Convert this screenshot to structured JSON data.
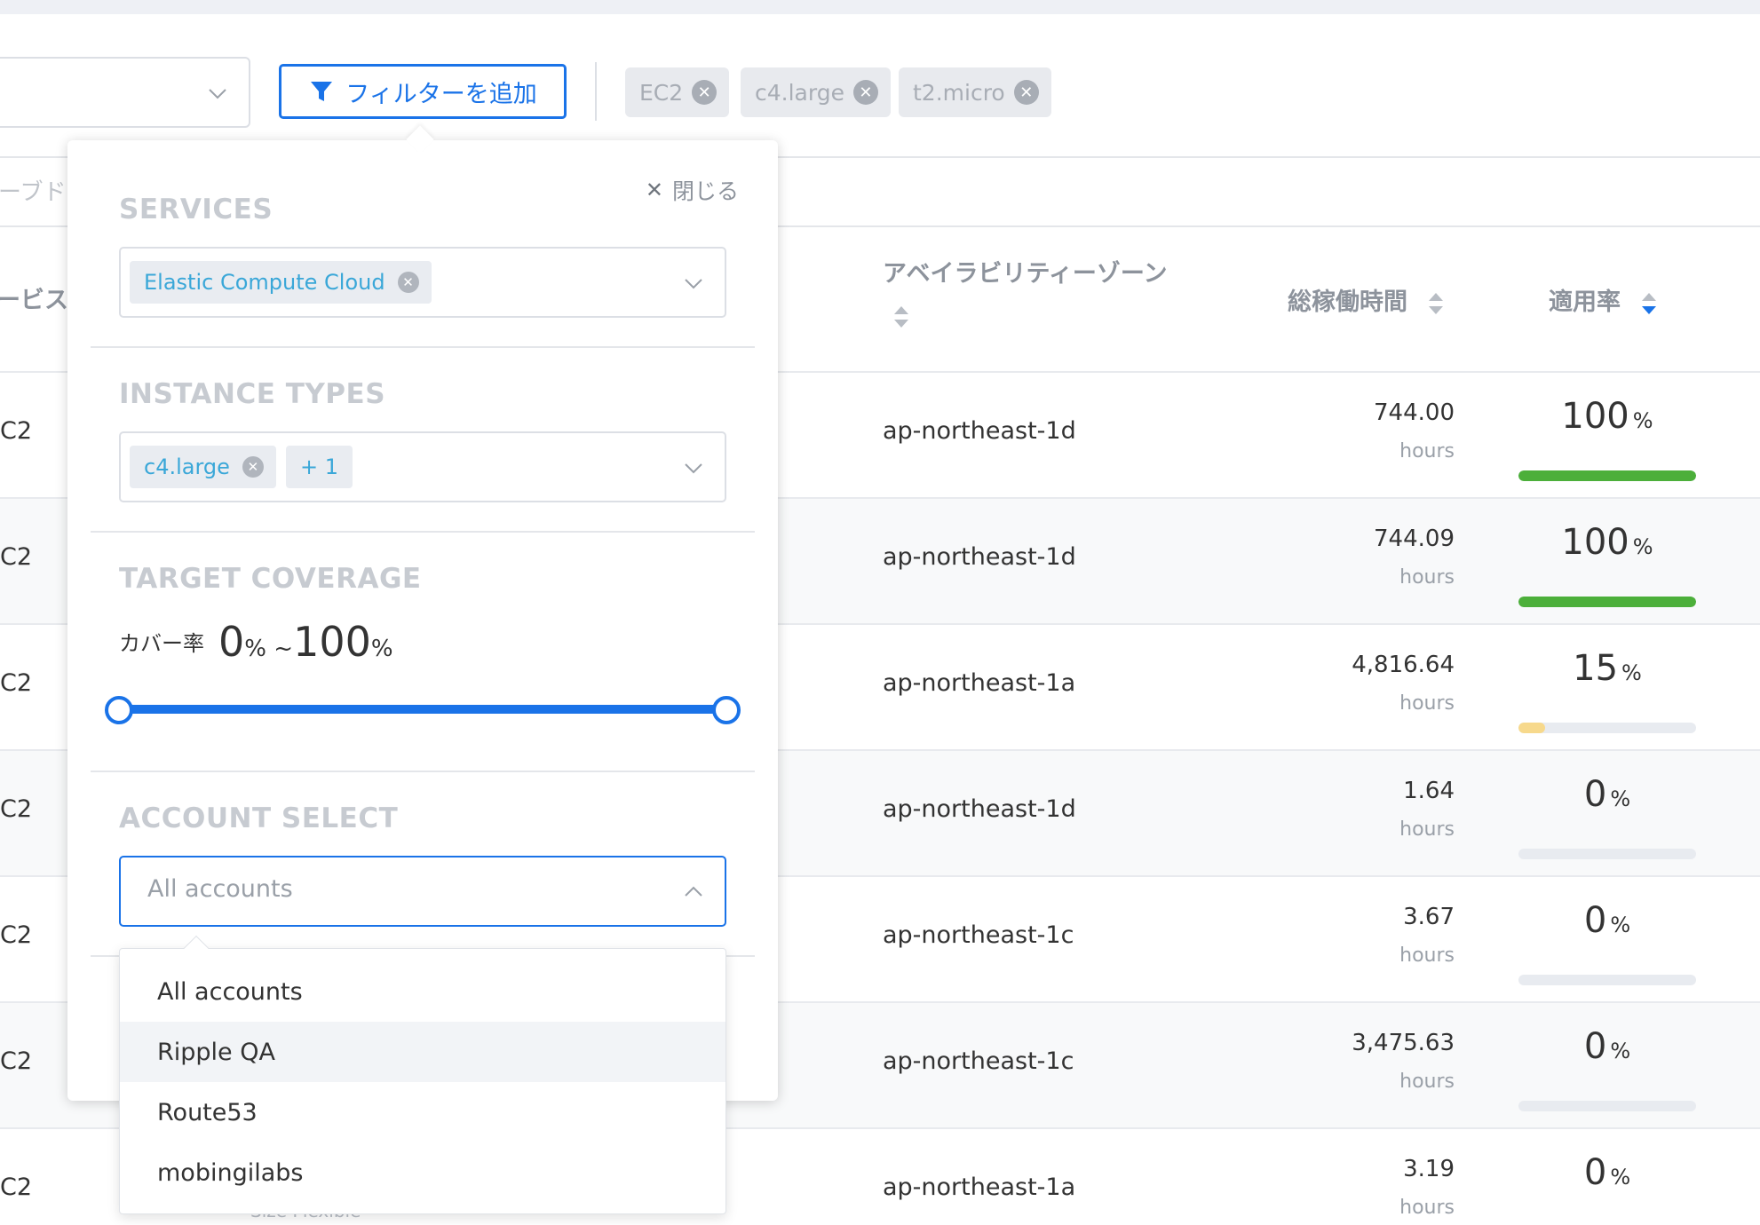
{
  "toolbar": {
    "filter_button_label": "フィルターを追加",
    "active_filters": [
      "EC2",
      "c4.large",
      "t2.micro"
    ]
  },
  "background": {
    "faded_search_text": "ーブド",
    "col_service_header": "ービス"
  },
  "table": {
    "headers": {
      "availability_zone": "アベイラビリティーゾーン",
      "total_hours": "総稼働時間",
      "coverage_rate": "適用率"
    },
    "rows": [
      {
        "service": "C2",
        "az": "ap-northeast-1d",
        "hours": "744.00",
        "hours_unit": "hours",
        "rate": "100",
        "rate_unit": "%",
        "rate_value": 100,
        "bar_color": "#4caf3a"
      },
      {
        "service": "C2",
        "az": "ap-northeast-1d",
        "hours": "744.09",
        "hours_unit": "hours",
        "rate": "100",
        "rate_unit": "%",
        "rate_value": 100,
        "bar_color": "#4caf3a"
      },
      {
        "service": "C2",
        "az": "ap-northeast-1a",
        "hours": "4,816.64",
        "hours_unit": "hours",
        "rate": "15",
        "rate_unit": "%",
        "rate_value": 15,
        "bar_color": "#f7d98c"
      },
      {
        "service": "C2",
        "az": "ap-northeast-1d",
        "hours": "1.64",
        "hours_unit": "hours",
        "rate": "0",
        "rate_unit": "%",
        "rate_value": 0,
        "bar_color": "#e8ebf0"
      },
      {
        "service": "C2",
        "az": "ap-northeast-1c",
        "hours": "3.67",
        "hours_unit": "hours",
        "rate": "0",
        "rate_unit": "%",
        "rate_value": 0,
        "bar_color": "#e8ebf0"
      },
      {
        "service": "C2",
        "az": "ap-northeast-1c",
        "hours": "3,475.63",
        "hours_unit": "hours",
        "rate": "0",
        "rate_unit": "%",
        "rate_value": 0,
        "bar_color": "#e8ebf0"
      },
      {
        "service": "C2",
        "az": "ap-northeast-1a",
        "hours": "3.19",
        "hours_unit": "hours",
        "rate": "0",
        "rate_unit": "%",
        "rate_value": 0,
        "bar_color": "#e8ebf0"
      }
    ],
    "behind_text": "Size Flexible"
  },
  "popover": {
    "close_label": "閉じる",
    "services": {
      "title": "SERVICES",
      "selected_tag": "Elastic Compute Cloud"
    },
    "instance_types": {
      "title": "INSTANCE TYPES",
      "selected_tag": "c4.large",
      "more_tag": "+ 1"
    },
    "target_coverage": {
      "title": "TARGET COVERAGE",
      "label": "カバー率",
      "min": "0",
      "max": "100",
      "unit": "%",
      "separator": " ~"
    },
    "account_select": {
      "title": "ACCOUNT SELECT",
      "value": "All accounts",
      "options": [
        "All accounts",
        "Ripple QA",
        "Route53",
        "mobingilabs"
      ],
      "hovered_index": 1
    }
  },
  "colors": {
    "accent": "#1a73e8",
    "bar_full": "#4caf3a",
    "bar_partial": "#f7d98c"
  }
}
